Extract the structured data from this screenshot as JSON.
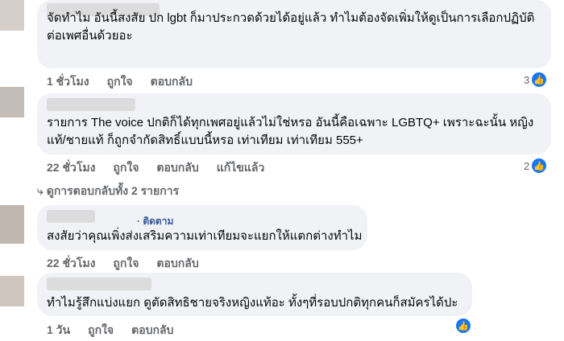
{
  "comments": [
    {
      "lines": [
        "จัดทำไม อันนี้สงสัย ปก lgbt ก็มาประกวดด้วยได้อยู่แล้ว ทำไมต้องจัดเพิ่มให้ดูเป็นการเลือกปฏิบัติ",
        "ต่อเพศอื่นด้วยอะ"
      ],
      "time": "1 ชั่วโมง",
      "like_label": "ถูกใจ",
      "reply_label": "ตอบกลับ",
      "reaction_count": "3"
    },
    {
      "lines": [
        "รายการ The voice ปกติก็ได้ทุกเพศอยู่แล้วไม่ใช่หรอ อันนี้คือเฉพาะ LGBTQ+ เพราะฉะนั้น หญิง",
        "แท้/ชายแท้ ก็ถูกจำกัดสิทธิ์แบบนี้หรอ เท่าเทียม เท่าเทียม 555+"
      ],
      "time": "22 ชั่วโมง",
      "like_label": "ถูกใจ",
      "reply_label": "ตอบกลับ",
      "edited_label": "แก้ไขแล้ว",
      "reaction_count": "2"
    },
    {
      "follow_label": "· ติดตาม",
      "lines": [
        "สงสัยว่าคุณเพิ่งส่งเสริมความเท่าเทียมจะแยกให้แตกต่างทำไม"
      ],
      "time": "22 ชั่วโมง",
      "like_label": "ถูกใจ",
      "reply_label": "ตอบกลับ"
    },
    {
      "lines": [
        "ทำไมรู้สึกแบ่งแยก ดูตัดสิทธิชายจริงหญิงแท้อะ ทั้งๆที่รอบปกติทุกคนก็สมัครได้ปะ"
      ],
      "time": "1 วัน",
      "like_label": "ถูกใจ",
      "reply_label": "ตอบกลับ"
    }
  ],
  "view_replies": "ดูการตอบกลับทั้ง 2 รายการ",
  "colors": {
    "bubble": "#f0f2f5",
    "like": "#1877f2",
    "meta": "#65676b"
  }
}
